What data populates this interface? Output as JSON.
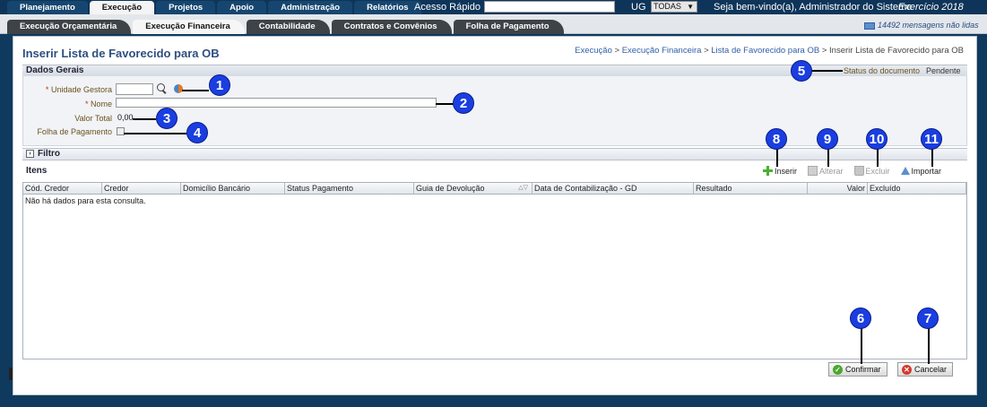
{
  "top_nav": {
    "tabs": [
      "Planejamento",
      "Execução",
      "Projetos",
      "Apoio",
      "Administração",
      "Relatórios"
    ],
    "active_tab": "Execução",
    "quick_access_label": "Acesso Rápido",
    "ug_label": "UG",
    "ug_value": "TODAS",
    "welcome": "Seja bem-vindo(a), Administrador do Sistema",
    "year": "Exercício 2018"
  },
  "sub_nav": {
    "tabs": [
      "Execução Orçamentária",
      "Execução Financeira",
      "Contabilidade",
      "Contratos e Convênios",
      "Folha de Pagamento"
    ],
    "active_tab": "Execução Financeira",
    "messages": "14492 mensagens não lidas"
  },
  "page": {
    "title": "Inserir Lista de Favorecido para OB",
    "breadcrumb": {
      "links": [
        "Execução",
        "Execução Financeira",
        "Lista de Favorecido para OB"
      ],
      "current": "Inserir Lista de Favorecido para OB",
      "separator": " > "
    }
  },
  "dados_gerais": {
    "section_title": "Dados Gerais",
    "unidade_gestora_label": "Unidade Gestora",
    "nome_label": "Nome",
    "valor_total_label": "Valor Total",
    "valor_total_value": "0,00",
    "folha_pagamento_label": "Folha de Pagamento",
    "required_mark": "*",
    "status_label": "Status do documento",
    "status_value": "Pendente"
  },
  "filtro": {
    "title": "Filtro"
  },
  "itens": {
    "title": "Itens",
    "actions": [
      {
        "label": "Inserir",
        "enabled": true,
        "icon": "plus-icon"
      },
      {
        "label": "Alterar",
        "enabled": false,
        "icon": "edit-icon"
      },
      {
        "label": "Excluir",
        "enabled": false,
        "icon": "trash-icon"
      },
      {
        "label": "Importar",
        "enabled": true,
        "icon": "upload-icon"
      }
    ],
    "columns": [
      "Cód. Credor",
      "Credor",
      "Domicílio Bancário",
      "Status Pagamento",
      "Guia de Devolução",
      "Data de Contabilização - GD",
      "Resultado",
      "Valor",
      "Excluído"
    ],
    "empty_message": "Não há dados para esta consulta."
  },
  "buttons": {
    "confirm": "Confirmar",
    "cancel": "Cancelar"
  },
  "markers": [
    "1",
    "2",
    "3",
    "4",
    "5",
    "6",
    "7",
    "8",
    "9",
    "10",
    "11"
  ],
  "colors": {
    "marker": "#1a3ee0",
    "top_bar": "#0e3559",
    "title": "#2f4f80"
  }
}
